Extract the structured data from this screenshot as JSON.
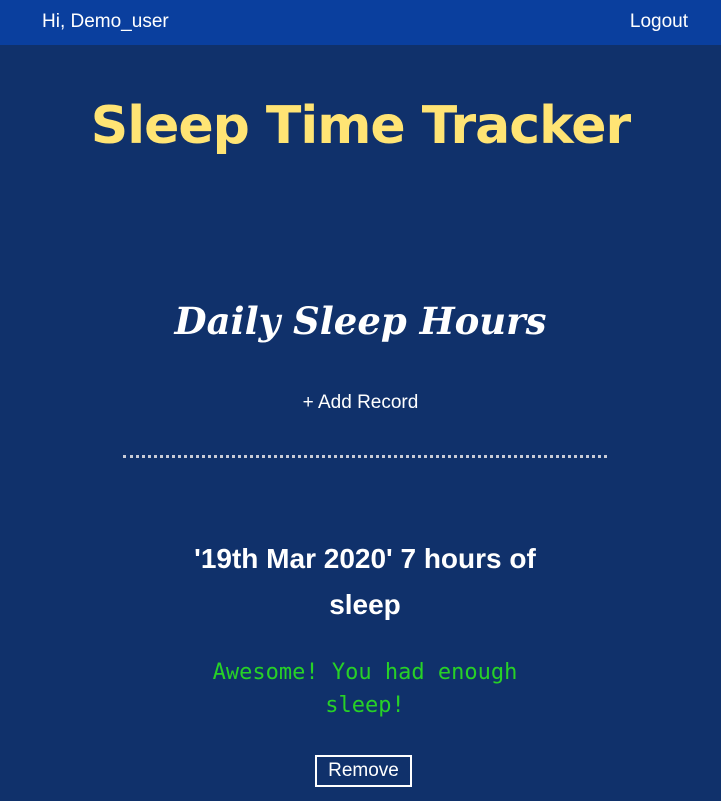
{
  "header": {
    "greeting": "Hi, Demo_user",
    "logout_label": "Logout"
  },
  "app": {
    "title": "Sleep Time Tracker"
  },
  "section": {
    "title": "Daily Sleep Hours",
    "add_record_label": "+ Add Record"
  },
  "records": [
    {
      "text": "'19th Mar 2020' 7 hours of sleep",
      "message": "Awesome! You had enough sleep!",
      "remove_label": "Remove"
    }
  ],
  "colors": {
    "background": "#10316b",
    "topbar": "#0a3f9e",
    "title": "#ffe474",
    "message": "#27d127"
  }
}
